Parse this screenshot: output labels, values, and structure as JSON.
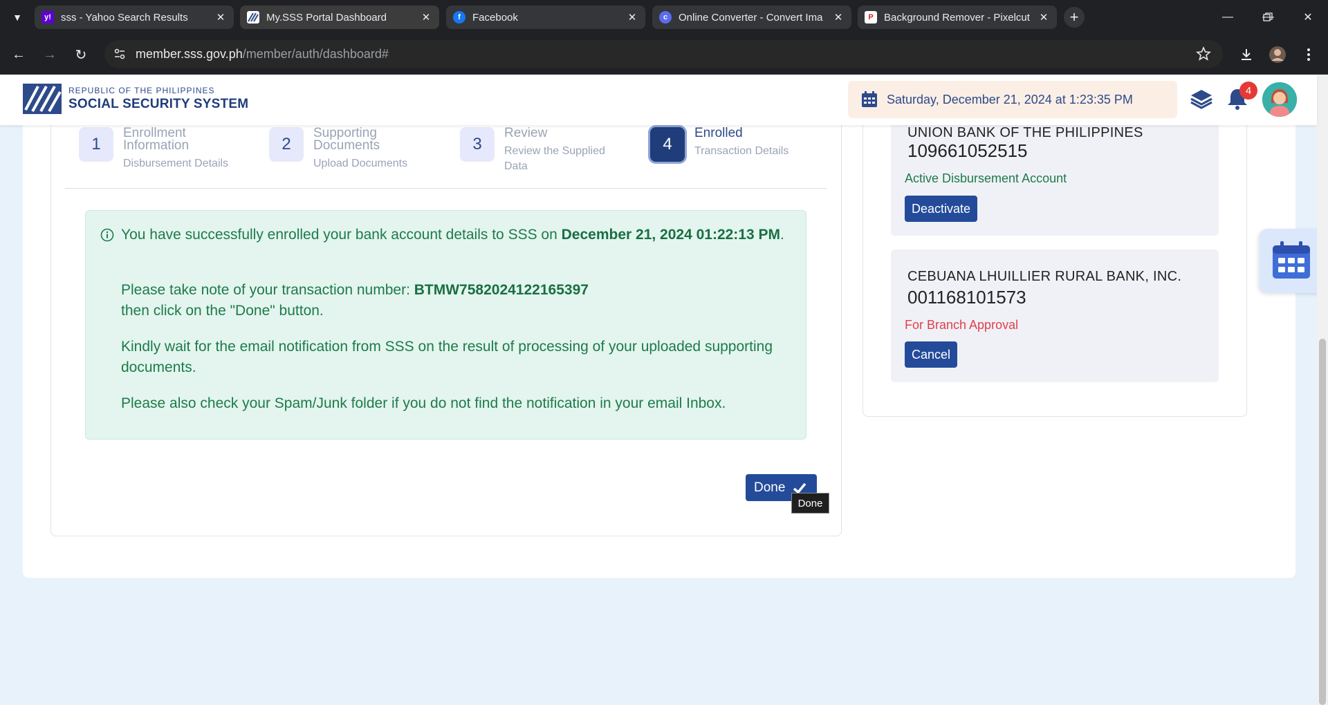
{
  "browser": {
    "tabs": [
      {
        "label": "sss - Yahoo Search Results",
        "favicon": "yahoo-icon",
        "active": false
      },
      {
        "label": "My.SSS Portal Dashboard",
        "favicon": "sss-icon",
        "active": true
      },
      {
        "label": "Facebook",
        "favicon": "facebook-icon",
        "active": false
      },
      {
        "label": "Online Converter - Convert Ima",
        "favicon": "converter-icon",
        "active": false
      },
      {
        "label": "Background Remover - Pixelcut",
        "favicon": "pixelcut-icon",
        "active": false
      }
    ],
    "url_host": "member.sss.gov.ph",
    "url_path": "/member/auth/dashboard#"
  },
  "header": {
    "logo_line1": "REPUBLIC OF THE PHILIPPINES",
    "logo_line2": "SOCIAL SECURITY SYSTEM",
    "datetime": "Saturday, December 21, 2024 at 1:23:35 PM",
    "notification_count": "4"
  },
  "steps": [
    {
      "number": "1",
      "title": "Enrollment Information",
      "subtitle": "Disbursement Details"
    },
    {
      "number": "2",
      "title": "Supporting Documents",
      "subtitle": "Upload Documents"
    },
    {
      "number": "3",
      "title": "Review",
      "subtitle": "Review the Supplied Data"
    },
    {
      "number": "4",
      "title": "Enrolled",
      "subtitle": "Transaction Details"
    }
  ],
  "message": {
    "p1_text": "You have successfully enrolled your bank account details to SSS on ",
    "p1_date": "December 21, 2024 01:22:13 PM",
    "p1_end": ".",
    "p2_text": "Please take note of your transaction number: ",
    "p2_txn": "BTMW7582024122165397",
    "p2_line2": "then click on the \"Done\" button.",
    "p3": "Kindly wait for the email notification from SSS on the result of processing of your uploaded supporting documents.",
    "p4": "Please also check your Spam/Junk folder if you do not find the notification in your email Inbox."
  },
  "done_button": {
    "label": "Done",
    "tooltip": "Done"
  },
  "accounts": [
    {
      "bank": "UNION BANK OF THE PHILIPPINES",
      "number": "109661052515",
      "status": "Active Disbursement Account",
      "status_color": "#1e7a4a",
      "button": "Deactivate"
    },
    {
      "bank": "CEBUANA LHUILLIER RURAL BANK, INC.",
      "number": "001168101573",
      "status": "For Branch Approval",
      "status_color": "#e0404a",
      "button": "Cancel"
    }
  ],
  "colors": {
    "primary": "#244b9a",
    "success": "#1e7a4a",
    "danger": "#e0404a"
  }
}
